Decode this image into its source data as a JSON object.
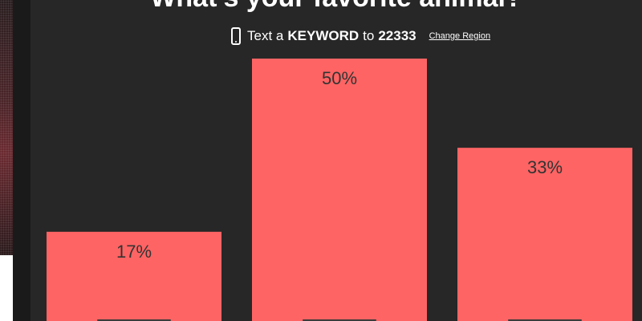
{
  "poll": {
    "title": "What's your favorite animal?",
    "text_prefix": "Text a",
    "keyword_label": "KEYWORD",
    "text_to": "to",
    "number": "22333",
    "change_region": "Change Region"
  },
  "colors": {
    "background": "#272727",
    "bar": "#ff6464",
    "text": "#ffffff",
    "label_text": "#333333"
  },
  "chart_data": {
    "type": "bar",
    "categories": [
      "",
      "",
      ""
    ],
    "values": [
      17,
      50,
      33
    ],
    "labels": [
      "17%",
      "50%",
      "33%"
    ],
    "ylim": [
      0,
      50
    ],
    "title": "What's your favorite animal?"
  }
}
